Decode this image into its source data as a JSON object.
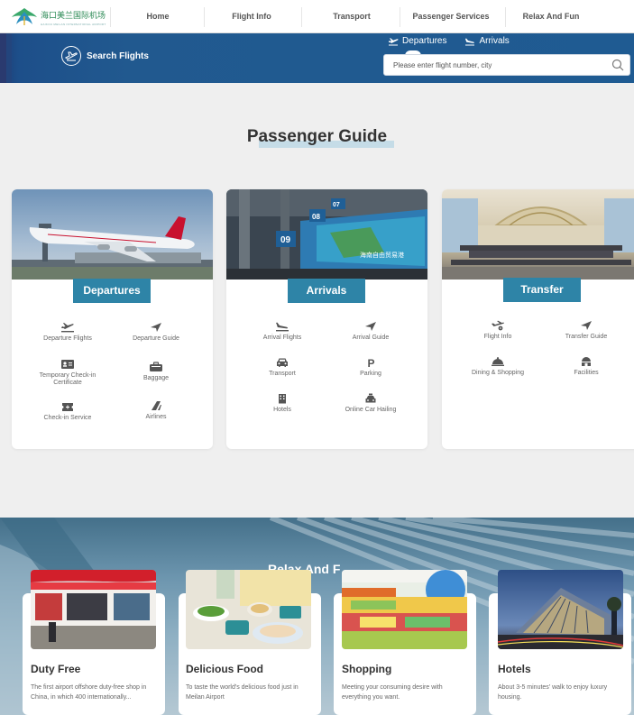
{
  "nav": {
    "logo_text": "海口美兰国际机场",
    "logo_sub": "HAIKOU MEILAN INTERNATIONAL AIRPORT",
    "items": [
      "Home",
      "Flight Info",
      "Transport",
      "Passenger Services",
      "Relax And Fun"
    ]
  },
  "banner": {
    "search_flights": "Search Flights",
    "tab_departures": "Departures",
    "tab_arrivals": "Arrivals",
    "search_placeholder": "Please enter flight number, city"
  },
  "guide": {
    "title": "Passenger Guide",
    "cards": [
      {
        "badge": "Departures",
        "items": [
          "Departure Flights",
          "Departure Guide",
          "Temporary Check-in Certificate",
          "Baggage",
          "Check-in Service",
          "Airlines"
        ]
      },
      {
        "badge": "Arrivals",
        "items": [
          "Arrival Flights",
          "Arrival Guide",
          "Transport",
          "Parking",
          "Hotels",
          "Online Car Hailing"
        ]
      },
      {
        "badge": "Transfer",
        "items": [
          "Flight Info",
          "Transfer Guide",
          "Dining & Shopping",
          "Facilities"
        ]
      }
    ],
    "screen_labels": [
      "09",
      "08",
      "07",
      "海南自由贸易港"
    ]
  },
  "relax": {
    "title": "Relax And F",
    "cards": [
      {
        "title": "Duty Free",
        "text": "The first airport offshore duty-free shop in China, in which 400 internationally..."
      },
      {
        "title": "Delicious Food",
        "text": "To taste the world's delicious food just in Meilan Airport"
      },
      {
        "title": "Shopping",
        "text": "Meeting your consuming desire with everything you want."
      },
      {
        "title": "Hotels",
        "text": "About 3-5 minutes' walk to enjoy luxury housing."
      }
    ]
  },
  "colors": {
    "banner": "#21598f",
    "badge": "#2e84a7",
    "logo_green": "#2e8b57"
  }
}
